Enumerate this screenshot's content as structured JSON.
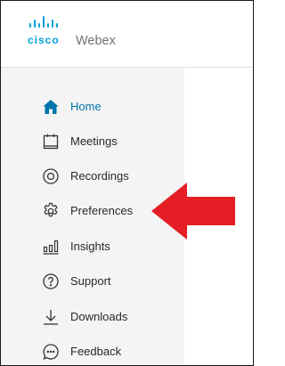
{
  "app": {
    "brand": "cisco",
    "product": "Webex",
    "accent_color": "#049fd9",
    "active_color": "#0074a8"
  },
  "nav": {
    "items": [
      {
        "label": "Home",
        "icon": "home-icon",
        "active": true
      },
      {
        "label": "Meetings",
        "icon": "meetings-icon",
        "active": false
      },
      {
        "label": "Recordings",
        "icon": "recordings-icon",
        "active": false
      },
      {
        "label": "Preferences",
        "icon": "gear-icon",
        "active": false
      },
      {
        "label": "Insights",
        "icon": "insights-icon",
        "active": false
      },
      {
        "label": "Support",
        "icon": "help-icon",
        "active": false
      },
      {
        "label": "Downloads",
        "icon": "download-icon",
        "active": false
      },
      {
        "label": "Feedback",
        "icon": "feedback-icon",
        "active": false
      }
    ]
  },
  "annotation": {
    "arrow_color": "#e51d24",
    "points_to": "Preferences"
  }
}
